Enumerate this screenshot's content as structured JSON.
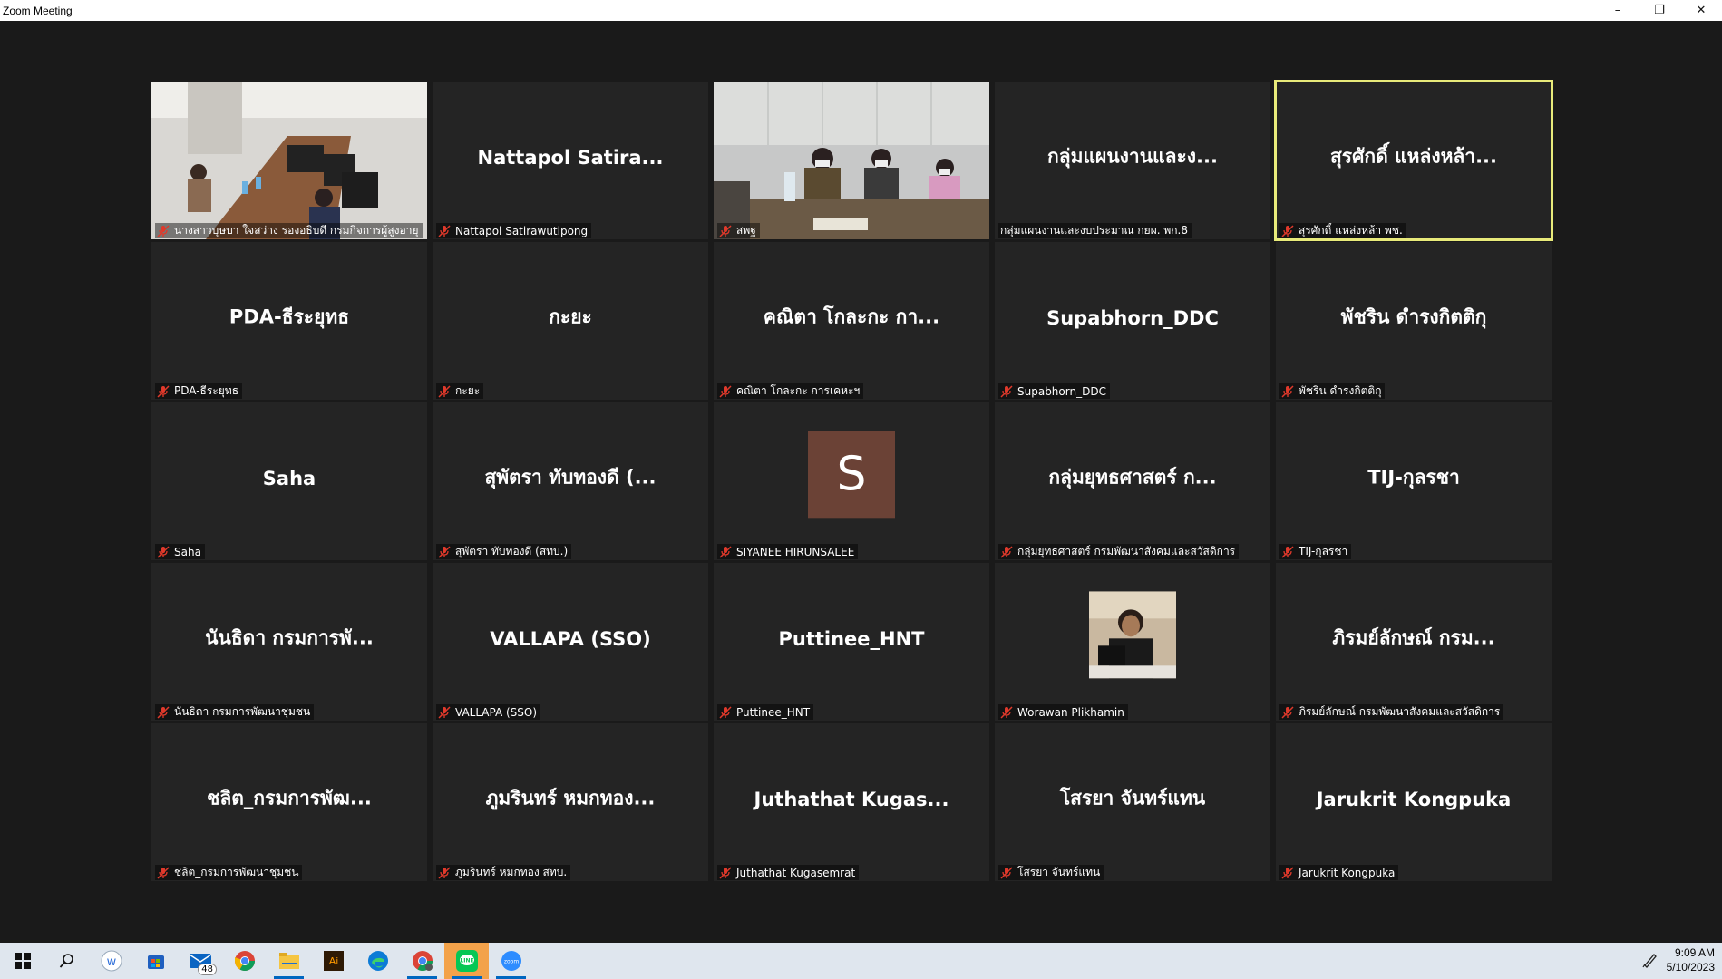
{
  "window": {
    "title": "Zoom Meeting",
    "minimize_glyph": "–",
    "restore_glyph": "❐",
    "close_glyph": "✕"
  },
  "colors": {
    "active_speaker_border": "#e8ea7a",
    "tile_bg": "#242424",
    "stage_bg": "#1a1a1a",
    "muted_icon": "#e0392b",
    "avatar_s_bg": "#6b4236"
  },
  "tiles": [
    {
      "type": "video",
      "label": "นางสาวบุษบา  ใจสว่าง รองอธิบดี กรมกิจการผู้สูงอายุ"
    },
    {
      "type": "name",
      "display": "Nattapol Satira...",
      "label": "Nattapol Satirawutipong"
    },
    {
      "type": "video",
      "label": "สพฐ"
    },
    {
      "type": "name",
      "display": "กลุ่มแผนงานและง...",
      "label": "กลุ่มแผนงานและงบประมาณ กยผ. พก.8",
      "no_mic": true
    },
    {
      "type": "name",
      "display": "สุรศักดิ์ แหล่งหล้า...",
      "label": "สุรศักดิ์ แหล่งหล้า พช.",
      "active": true
    },
    {
      "type": "name",
      "display": "PDA-ธีระยุทธ",
      "label": "PDA-ธีระยุทธ"
    },
    {
      "type": "name",
      "display": "กะยะ",
      "label": "กะยะ"
    },
    {
      "type": "name",
      "display": "คณิตา โกละกะ กา...",
      "label": "คณิตา โกละกะ การเคหะฯ"
    },
    {
      "type": "name",
      "display": "Supabhorn_DDC",
      "label": "Supabhorn_DDC"
    },
    {
      "type": "name",
      "display": "พัชริน ดำรงกิตติกุ",
      "label": "พัชริน ดำรงกิตติกุ"
    },
    {
      "type": "name",
      "display": "Saha",
      "label": "Saha"
    },
    {
      "type": "name",
      "display": "สุพัตรา ทับทองดี (...",
      "label": "สุพัตรา ทับทองดี (สทบ.)"
    },
    {
      "type": "avatar",
      "initial": "S",
      "label": "SIYANEE HIRUNSALEE"
    },
    {
      "type": "name",
      "display": "กลุ่มยุทธศาสตร์ ก...",
      "label": "กลุ่มยุทธศาสตร์ กรมพัฒนาสังคมและสวัสดิการ"
    },
    {
      "type": "name",
      "display": "TIJ-กุลรชา",
      "label": "TIJ-กุลรชา"
    },
    {
      "type": "name",
      "display": "นันธิดา กรมการพั...",
      "label": "นันธิดา กรมการพัฒนาชุมชน"
    },
    {
      "type": "name",
      "display": "VALLAPA (SSO)",
      "label": "VALLAPA (SSO)"
    },
    {
      "type": "name",
      "display": "Puttinee_HNT",
      "label": "Puttinee_HNT"
    },
    {
      "type": "photo",
      "label": "Worawan Plikhamin"
    },
    {
      "type": "name",
      "display": "ภิรมย์ลักษณ์ กรม...",
      "label": "ภิรมย์ลักษณ์ กรมพัฒนาสังคมและสวัสดิการ"
    },
    {
      "type": "name",
      "display": "ชลิต_กรมการพัฒ...",
      "label": "ชลิต_กรมการพัฒนาชุมชน"
    },
    {
      "type": "name",
      "display": "ภูมรินทร์ หมกทอง...",
      "label": "ภูมรินทร์ หมกทอง สทบ."
    },
    {
      "type": "name",
      "display": "Juthathat Kugas...",
      "label": "Juthathat Kugasemrat"
    },
    {
      "type": "name",
      "display": "โสรยา จันทร์แทน",
      "label": "โสรยา จันทร์แทน"
    },
    {
      "type": "name",
      "display": "Jarukrit Kongpuka",
      "label": "Jarukrit Kongpuka"
    }
  ],
  "taskbar": {
    "icons": [
      "windows-start-icon",
      "search-icon",
      "word-like-app-icon",
      "store-icon",
      "mail-icon",
      "chrome-icon",
      "file-explorer-icon",
      "illustrator-icon",
      "edge-icon",
      "chrome-profile-icon",
      "line-icon",
      "zoom-icon"
    ],
    "mail_badge": "48",
    "time": "9:09 AM",
    "date": "5/10/2023"
  }
}
